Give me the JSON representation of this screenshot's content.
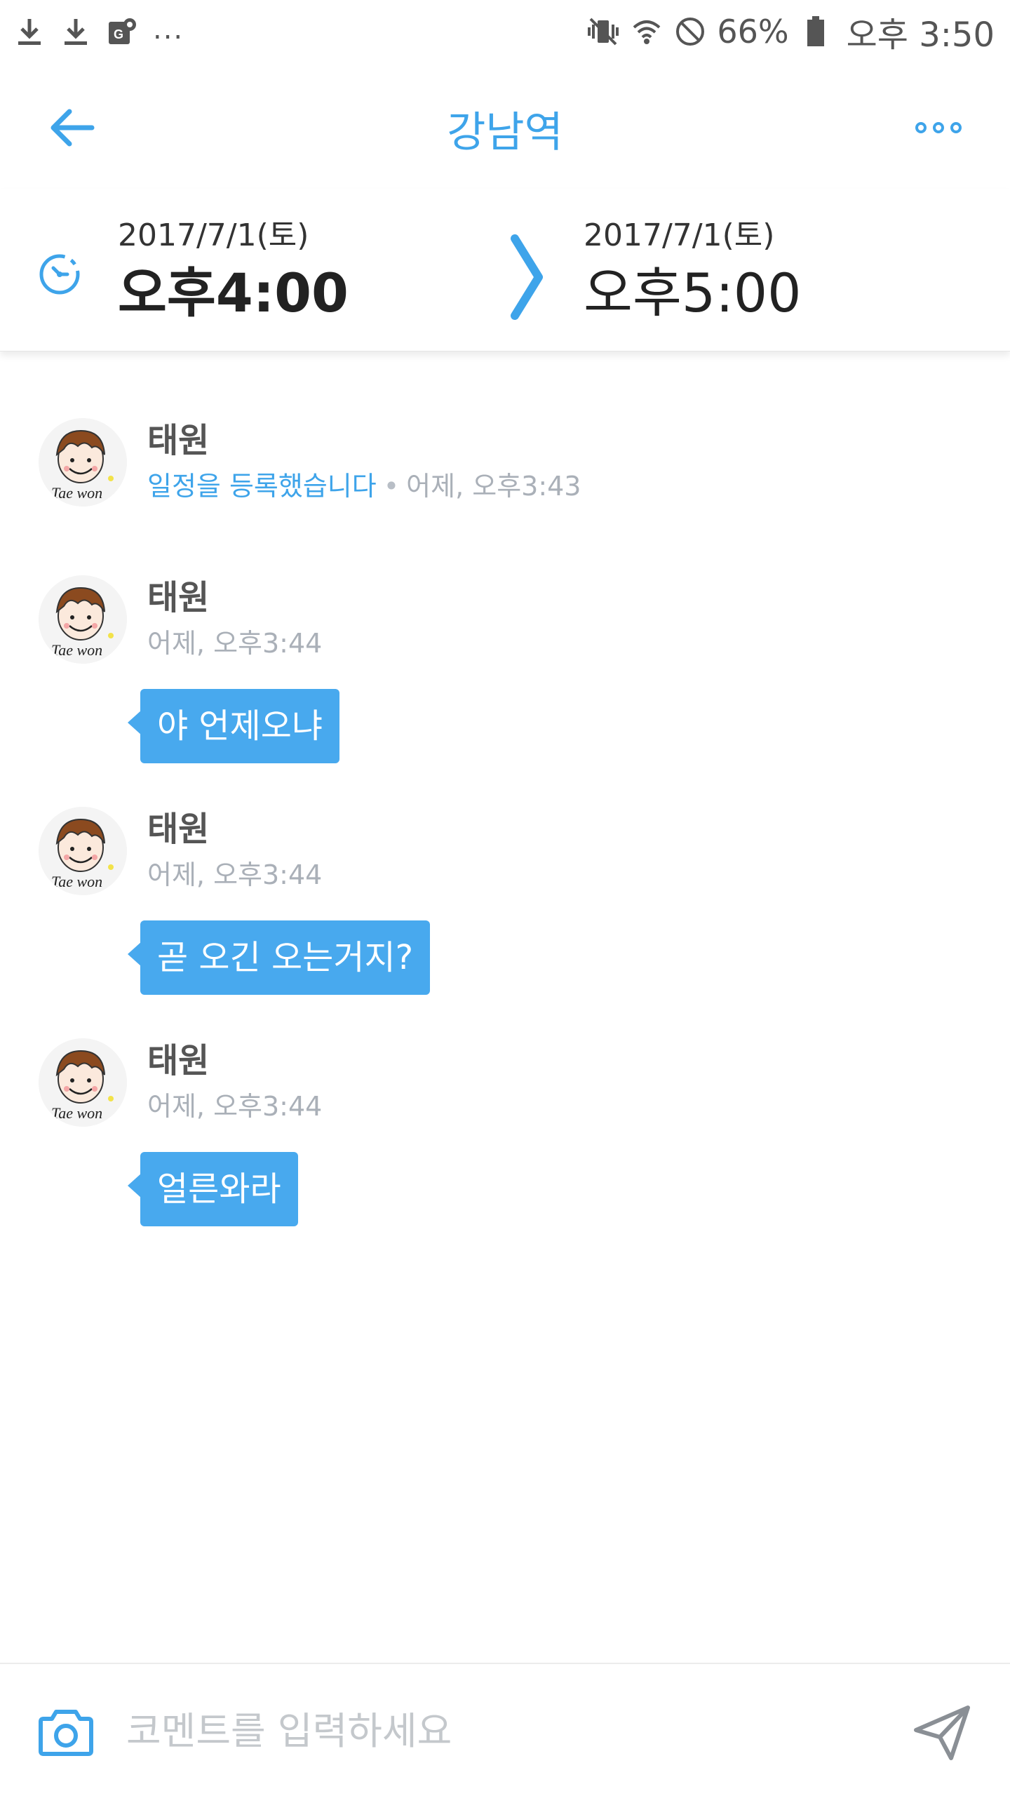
{
  "status_bar": {
    "left_icons": [
      "download-icon",
      "download-icon",
      "maps-icon"
    ],
    "overflow": "...",
    "right_icons": [
      "vibrate-icon",
      "wifi-icon",
      "do-not-disturb-icon",
      "battery-icon"
    ],
    "battery_percent": "66%",
    "time": "오후 3:50"
  },
  "header": {
    "title": "강남역",
    "back_icon": "back-arrow-icon",
    "more_icon": "more-icon"
  },
  "time_range": {
    "start": {
      "date": "2017/7/1(토)",
      "time": "오후4:00"
    },
    "end": {
      "date": "2017/7/1(토)",
      "time": "오후5:00"
    }
  },
  "feed": [
    {
      "author": "태원",
      "action": "일정을 등록했습니다",
      "separator": "•",
      "timestamp": "어제, 오후3:43",
      "message": ""
    },
    {
      "author": "태원",
      "timestamp": "어제, 오후3:44",
      "message": "야 언제오냐"
    },
    {
      "author": "태원",
      "timestamp": "어제, 오후3:44",
      "message": "곧 오긴 오는거지?"
    },
    {
      "author": "태원",
      "timestamp": "어제, 오후3:44",
      "message": "얼른와라"
    }
  ],
  "avatar_caption": "Tae won",
  "comment_bar": {
    "placeholder": "코멘트를 입력하세요"
  },
  "colors": {
    "accent": "#3ea4ea",
    "bubble": "#48a9ee",
    "meta_text": "#aab0b8",
    "author_text": "#555555"
  }
}
